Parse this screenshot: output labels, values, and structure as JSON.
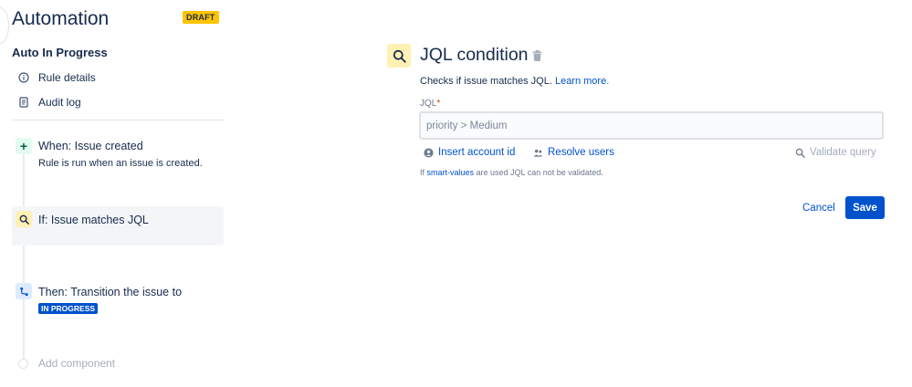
{
  "header": {
    "title": "Automation",
    "badge": "DRAFT"
  },
  "sidebar": {
    "rule_name": "Auto In Progress",
    "links": [
      {
        "label": "Rule details",
        "icon": "info-icon"
      },
      {
        "label": "Audit log",
        "icon": "document-icon"
      }
    ],
    "steps": {
      "when": {
        "title": "When: Issue created",
        "description": "Rule is run when an issue is created.",
        "icon": "plus-icon"
      },
      "if": {
        "title": "If: Issue matches JQL",
        "icon": "search-icon"
      },
      "then": {
        "title": "Then: Transition the issue to",
        "status": "IN PROGRESS",
        "icon": "branch-icon"
      }
    },
    "add_component": "Add component"
  },
  "panel": {
    "title": "JQL condition",
    "description": "Checks if issue matches JQL.",
    "learn_more": "Learn more.",
    "field_label": "JQL",
    "required_marker": "*",
    "jql_placeholder": "priority > Medium",
    "jql_value": "",
    "actions": {
      "insert_account": "Insert account id",
      "resolve_users": "Resolve users",
      "validate_query": "Validate query"
    },
    "hint_prefix": "If ",
    "hint_link": "smart-values",
    "hint_suffix": " are used JQL can not be validated.",
    "cancel": "Cancel",
    "save": "Save"
  },
  "colors": {
    "accent": "#0052cc",
    "draft_badge": "#ffc400",
    "condition_icon_bg": "#fff0b3",
    "trigger_icon_bg": "#e3fcef",
    "action_icon_bg": "#deebff"
  }
}
